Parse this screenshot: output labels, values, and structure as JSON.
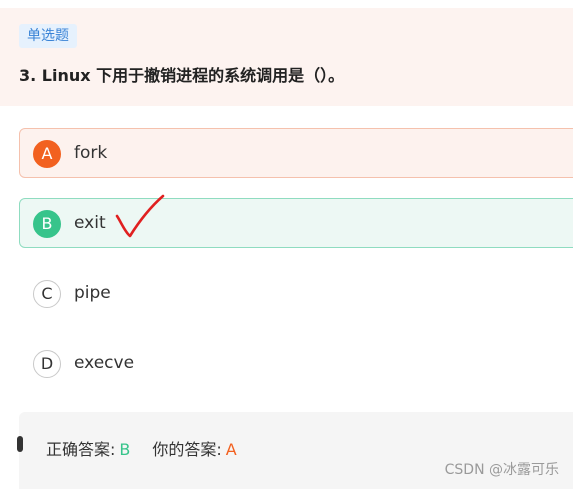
{
  "question": {
    "type_badge": "单选题",
    "text": "3. Linux 下用于撤销进程的系统调用是（）。"
  },
  "options": [
    {
      "letter": "A",
      "text": "fork",
      "state": "selected-wrong"
    },
    {
      "letter": "B",
      "text": "exit",
      "state": "correct"
    },
    {
      "letter": "C",
      "text": "pipe",
      "state": "none"
    },
    {
      "letter": "D",
      "text": "execve",
      "state": "none"
    }
  ],
  "answer": {
    "correct_label": "正确答案:",
    "correct_value": "B",
    "yours_label": "你的答案:",
    "yours_value": "A"
  },
  "watermark": "CSDN @冰露可乐",
  "colors": {
    "header_bg": "#fdf3f0",
    "wrong": "#f26120",
    "correct": "#37c48b",
    "badge_text": "#3a83d6",
    "check_mark": "#e02020"
  },
  "icons": {
    "check": "red-handwritten-check-icon"
  }
}
